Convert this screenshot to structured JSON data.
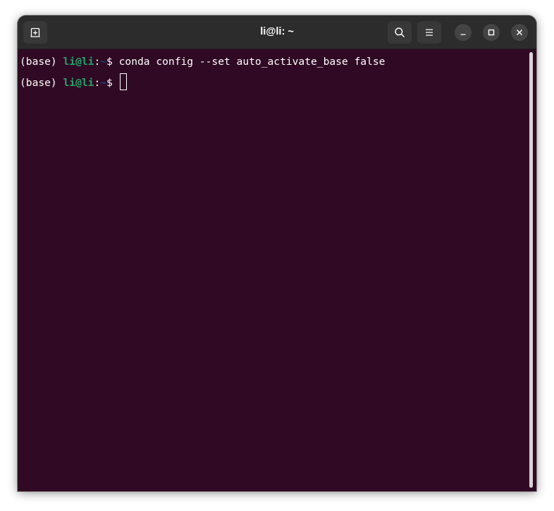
{
  "window": {
    "title": "li@li: ~"
  },
  "titlebar": {
    "buttons": [
      {
        "name": "new-tab",
        "icon": "new-tab-icon"
      },
      {
        "name": "search",
        "icon": "search-icon"
      },
      {
        "name": "menu",
        "icon": "hamburger-menu-icon"
      },
      {
        "name": "minimize",
        "icon": "minimize-icon"
      },
      {
        "name": "maximize",
        "icon": "maximize-icon"
      },
      {
        "name": "close",
        "icon": "close-icon"
      }
    ]
  },
  "terminal": {
    "lines": [
      {
        "env": "(base) ",
        "user": "li@li",
        "sep": ":",
        "path": "~",
        "prompt": "$ ",
        "command": "conda config --set auto_activate_base false"
      },
      {
        "env": "(base) ",
        "user": "li@li",
        "sep": ":",
        "path": "~",
        "prompt": "$ ",
        "command": ""
      }
    ]
  },
  "colors": {
    "background": "#300a24",
    "titlebar": "#2c2c2c",
    "user": "#26a269",
    "path": "#12488b",
    "text": "#ffffff"
  }
}
